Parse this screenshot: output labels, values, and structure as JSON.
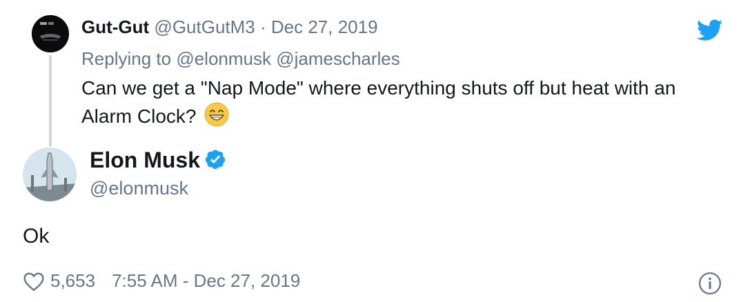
{
  "reply_tweet": {
    "display_name": "Gut-Gut",
    "handle": "@GutGutM3",
    "separator": "·",
    "date": "Dec 27, 2019",
    "replying_to_prefix": "Replying to",
    "replying_to_handles": "@elonmusk @jamescharles",
    "text": "Can we get a \"Nap Mode\" where everything shuts off but heat with an Alarm Clock?",
    "emoji": "grinning-face-emoji"
  },
  "main_tweet": {
    "display_name": "Elon Musk",
    "handle": "@elonmusk",
    "verified": true,
    "text": "Ok",
    "likes": "5,653",
    "timestamp": "7:55 AM - Dec 27, 2019"
  },
  "icons": {
    "brand": "twitter-bird-icon",
    "like": "heart-icon",
    "info": "info-icon",
    "verified": "verified-badge-icon"
  },
  "colors": {
    "twitter_blue": "#1da1f2",
    "text": "#14171a",
    "muted": "#657786",
    "thread_line": "#ccd6dd"
  }
}
